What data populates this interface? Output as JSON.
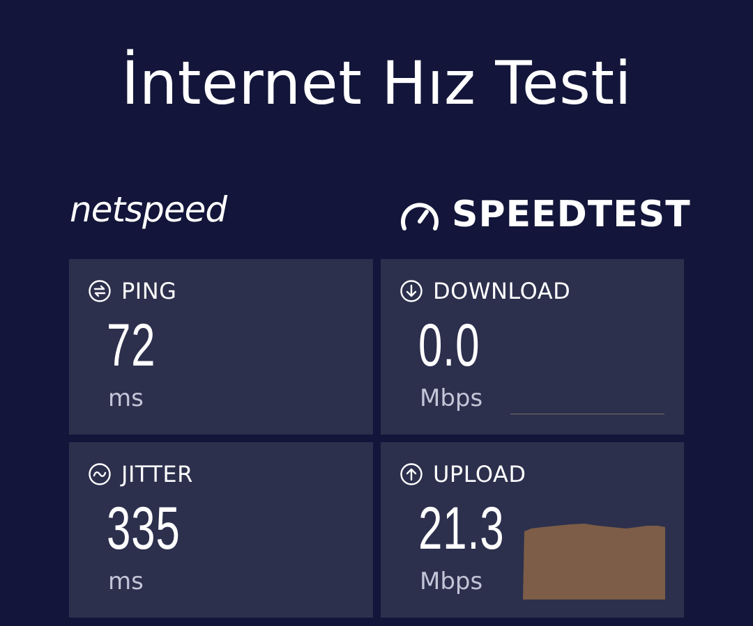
{
  "page": {
    "title": "İnternet Hız Testi"
  },
  "logos": {
    "netspeed": "netspeed",
    "speedtest": "SPEEDTEST",
    "speedtest_mark": "®"
  },
  "metrics": {
    "ping": {
      "label": "PING",
      "value": "72",
      "unit": "ms",
      "icon": "ping-icon"
    },
    "jitter": {
      "label": "JITTER",
      "value": "335",
      "unit": "ms",
      "icon": "jitter-icon"
    },
    "download": {
      "label": "DOWNLOAD",
      "value": "0.0",
      "unit": "Mbps",
      "icon": "download-arrow-icon"
    },
    "upload": {
      "label": "UPLOAD",
      "value": "21.3",
      "unit": "Mbps",
      "icon": "upload-arrow-icon"
    }
  },
  "colors": {
    "background": "#13163a",
    "card": "#2c304d",
    "text": "#ffffff",
    "unit_text": "#c3c6d8",
    "upload_graph": "#7d5d47",
    "download_line": "#7a6a66"
  }
}
